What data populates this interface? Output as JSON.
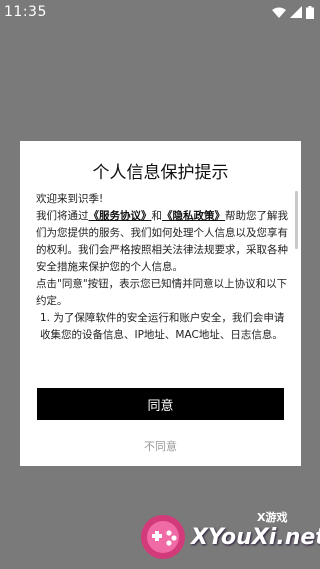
{
  "status_bar": {
    "time": "11:35",
    "icons": [
      "wifi-icon",
      "signal-icon",
      "battery-icon"
    ]
  },
  "dialog": {
    "title": "个人信息保护提示",
    "greeting": "欢迎来到识季!",
    "p1_before": "我们将通过",
    "service_link": "《服务协议》",
    "p1_and": "和",
    "privacy_link": "《隐私政策》",
    "p1_after": "帮助您了解我们为您提供的服务、我们如何处理个人信息以及您享有的权利。我们会严格按照相关法律法规要求，采取各种安全措施来保护您的个人信息。",
    "p2": "点击\"同意\"按钮，表示您已知情并同意以上协议和以下约定。",
    "p3": "1. 为了保障软件的安全运行和账户安全，我们会申请收集您的设备信息、IP地址、MAC地址、日志信息。",
    "agree_label": "同意",
    "disagree_label": "不同意"
  },
  "watermark": {
    "small": "X游戏",
    "big": "XYouXi.net"
  },
  "colors": {
    "overlay": "#7a7a7a",
    "button": "#000000",
    "disagree_text": "#999999"
  }
}
